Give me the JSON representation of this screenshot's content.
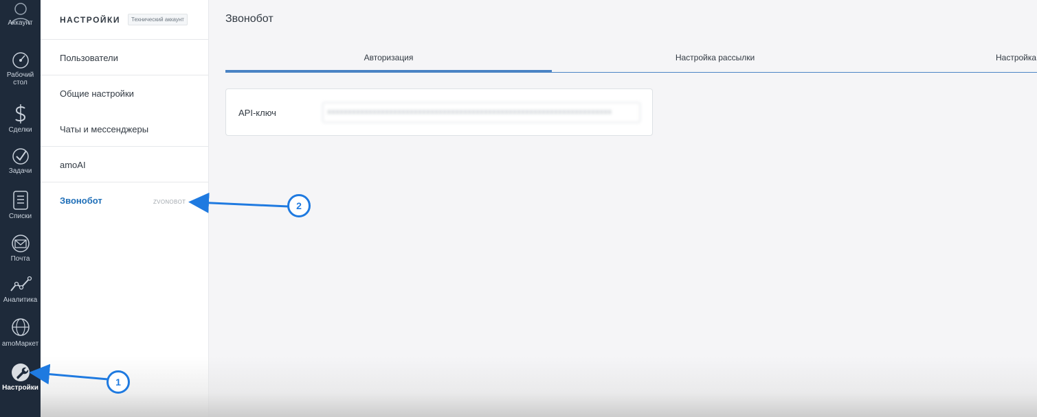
{
  "nav": {
    "items": [
      {
        "label": "Аккаунт",
        "icon": "user-icon"
      },
      {
        "label": "Рабочий стол",
        "icon": "dashboard-icon"
      },
      {
        "label": "Сделки",
        "icon": "dollar-icon"
      },
      {
        "label": "Задачи",
        "icon": "check-icon"
      },
      {
        "label": "Списки",
        "icon": "list-icon"
      },
      {
        "label": "Почта",
        "icon": "mail-icon"
      },
      {
        "label": "Аналитика",
        "icon": "analytics-icon"
      },
      {
        "label": "amoМаркет",
        "icon": "market-icon"
      },
      {
        "label": "Настройки",
        "icon": "wrench-icon"
      }
    ]
  },
  "settings": {
    "title": "НАСТРОЙКИ",
    "badge": "Технический аккаунт",
    "items": [
      {
        "label": "Пользователи"
      },
      {
        "label": "Общие настройки"
      },
      {
        "label": "Чаты и мессенджеры"
      },
      {
        "label": "amoAI"
      },
      {
        "label": "Звонобот",
        "code": "ZVONOBOT"
      }
    ]
  },
  "main": {
    "title": "Звонобот",
    "tabs": [
      {
        "label": "Авторизация"
      },
      {
        "label": "Настройка рассылки"
      },
      {
        "label": "Настройка"
      }
    ],
    "api_key": {
      "label": "API-ключ",
      "value": "xxxxxxxxxxxxxxxxxxxxxxxxxxxxxxxxxxxxxxxxxxxxxxxxxxxxxxxxxxxxxxxxxxxxx"
    }
  },
  "annotations": {
    "callout_1": "1",
    "callout_2": "2"
  },
  "colors": {
    "nav_bg": "#1e2a3a",
    "accent": "#4a83c4",
    "callout": "#1f7ae0"
  }
}
